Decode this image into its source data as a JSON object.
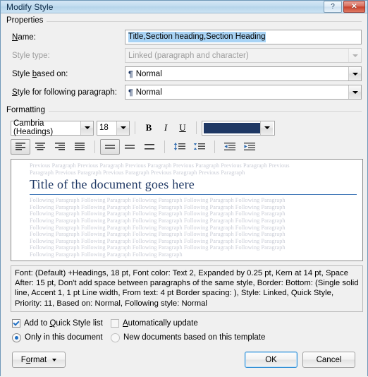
{
  "window": {
    "title": "Modify Style",
    "help_button": "?",
    "close_button": "✕"
  },
  "properties": {
    "group_label": "Properties",
    "name_label": "Name:",
    "name_value": "Title,Section heading,Section Heading",
    "style_type_label": "Style type:",
    "style_type_value": "Linked (paragraph and character)",
    "style_based_on_label": "Style based on:",
    "style_based_on_value": "Normal",
    "style_following_label": "Style for following paragraph:",
    "style_following_value": "Normal",
    "pilcrow": "¶"
  },
  "formatting": {
    "group_label": "Formatting",
    "font_name": "Cambria (Headings)",
    "font_size": "18",
    "bold": "B",
    "italic": "I",
    "underline": "U",
    "font_color_hex": "#1F3864",
    "align_left": "align-left",
    "align_center": "align-center",
    "align_right": "align-right",
    "align_justify": "align-justify",
    "line_spacing_single": "line-spacing-single",
    "line_spacing_1_5": "line-spacing-1-5",
    "line_spacing_double": "line-spacing-double",
    "decrease_spacing": "decrease-paragraph-spacing",
    "increase_spacing": "increase-paragraph-spacing",
    "decrease_indent": "decrease-indent",
    "increase_indent": "increase-indent"
  },
  "preview": {
    "previous_line_1": "Previous Paragraph Previous Paragraph Previous Paragraph Previous Paragraph Previous Paragraph Previous",
    "previous_line_2": "Paragraph Previous Paragraph Previous Paragraph Previous Paragraph Previous Paragraph",
    "title": "Title of the document goes here",
    "following_full": "Following Paragraph Following Paragraph Following Paragraph Following Paragraph Following Paragraph",
    "following_last": "Following Paragraph Following Paragraph Following Paragraph"
  },
  "description": {
    "text": "Font: (Default) +Headings, 18 pt, Font color: Text 2, Expanded by  0.25 pt, Kern at 14 pt, Space After:  15 pt, Don't add space between paragraphs of the same style, Border: Bottom: (Single solid line, Accent 1,  1 pt Line width, From text:  4 pt Border spacing: ), Style: Linked, Quick Style, Priority: 11, Based on: Normal, Following style: Normal"
  },
  "options": {
    "add_to_quick_style": "Add to Quick Style list",
    "add_to_quick_style_checked": true,
    "automatically_update": "Automatically update",
    "automatically_update_checked": false,
    "only_this_document": "Only in this document",
    "only_this_document_selected": true,
    "new_documents": "New documents based on this template",
    "new_documents_selected": false
  },
  "footer": {
    "format": "Format",
    "ok": "OK",
    "cancel": "Cancel"
  }
}
